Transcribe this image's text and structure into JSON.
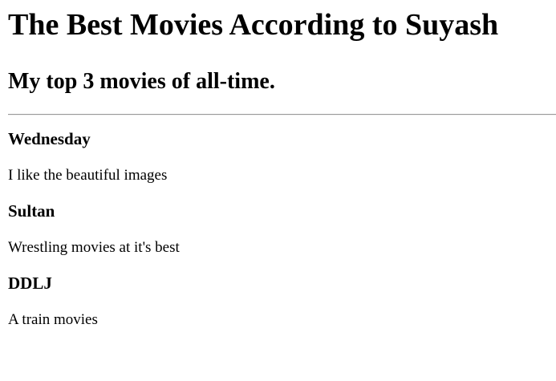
{
  "header": {
    "title": "The Best Movies According to Suyash",
    "subtitle": "My top 3 movies of all-time."
  },
  "movies": [
    {
      "name": "Wednesday",
      "description": "I like the beautiful images"
    },
    {
      "name": "Sultan",
      "description": "Wrestling movies at it's best"
    },
    {
      "name": "DDLJ",
      "description": "A train movies"
    }
  ]
}
